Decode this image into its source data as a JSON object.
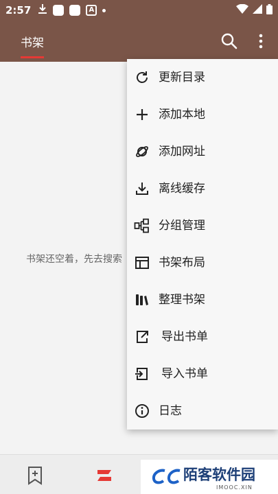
{
  "status_bar": {
    "time": "2:57",
    "badge_letter": "A"
  },
  "app_bar": {
    "tab_label": "书架"
  },
  "content": {
    "empty_message": "书架还空着，先去搜索"
  },
  "menu": {
    "items": [
      {
        "label": "更新目录",
        "icon": "refresh-icon"
      },
      {
        "label": "添加本地",
        "icon": "plus-icon"
      },
      {
        "label": "添加网址",
        "icon": "planet-icon"
      },
      {
        "label": "离线缓存",
        "icon": "download-icon"
      },
      {
        "label": "分组管理",
        "icon": "group-icon"
      },
      {
        "label": "书架布局",
        "icon": "layout-icon"
      },
      {
        "label": "整理书架",
        "icon": "books-icon"
      },
      {
        "label": "导出书单",
        "icon": "export-icon"
      },
      {
        "label": "导入书单",
        "icon": "import-icon"
      },
      {
        "label": "日志",
        "icon": "info-icon"
      }
    ]
  },
  "watermark": {
    "title": "陌客软件园",
    "subtitle": "IMOOC.XIN"
  },
  "colors": {
    "app_bar": "#7a5548",
    "accent": "#e53935",
    "background": "#f3f3f3"
  }
}
